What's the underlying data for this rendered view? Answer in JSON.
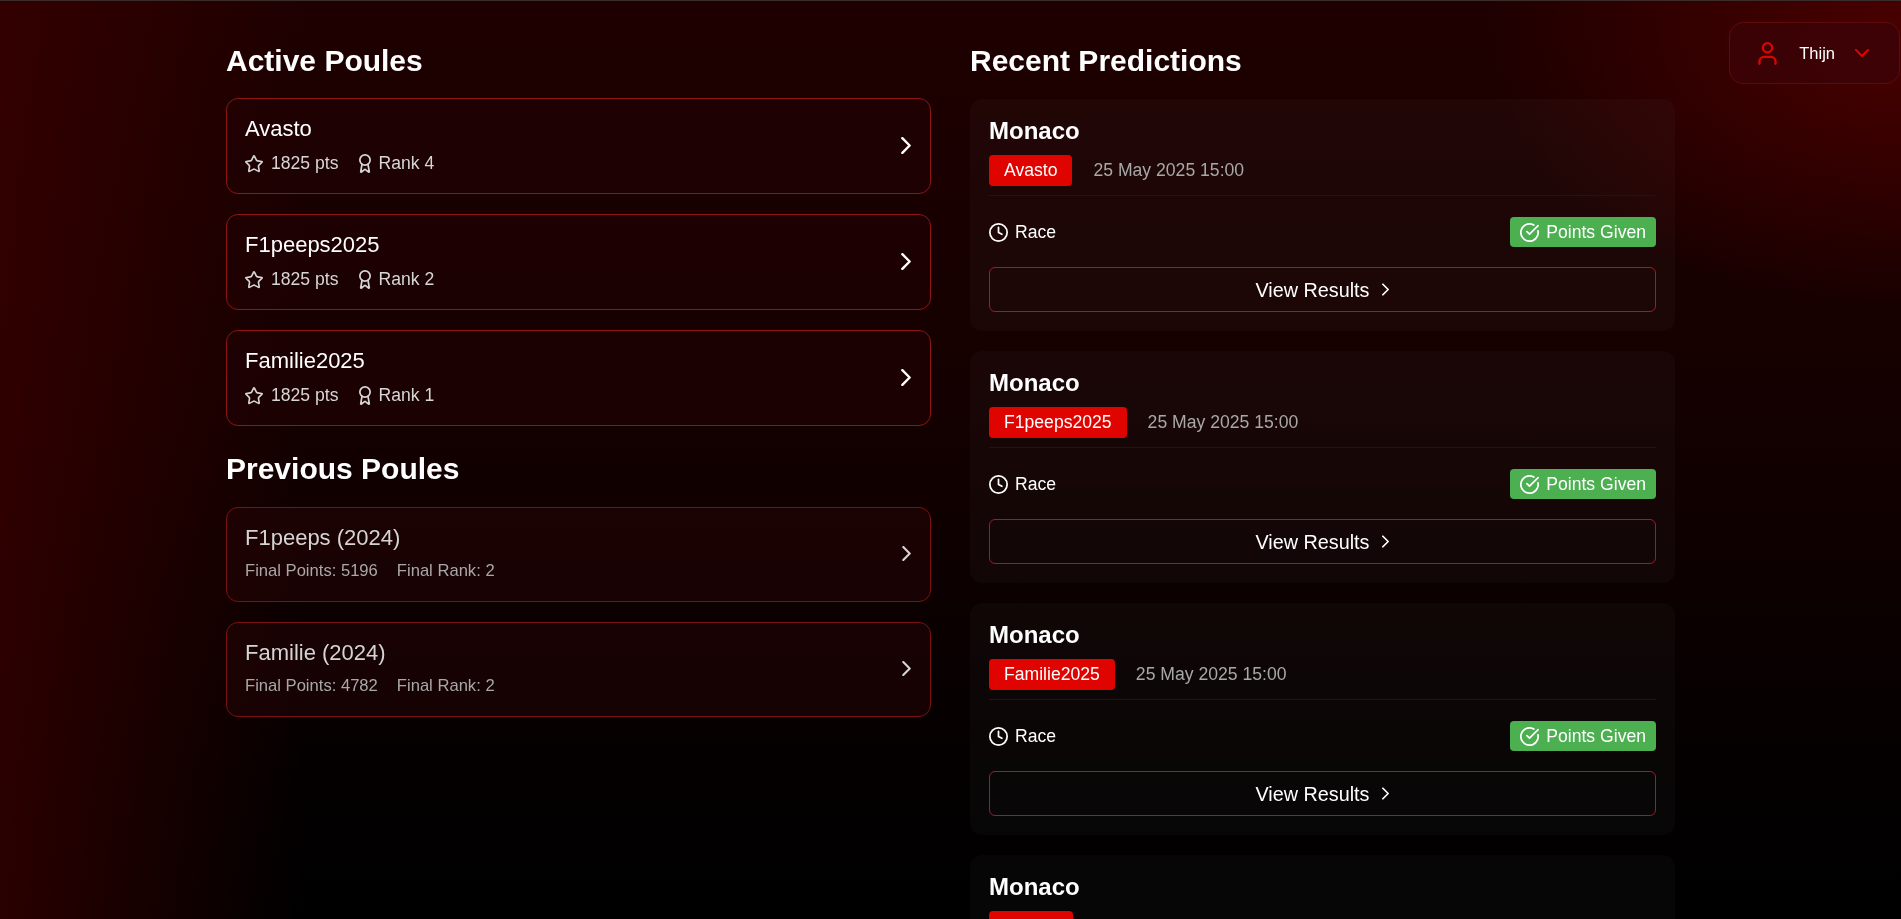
{
  "user_menu": {
    "name": "Thijn"
  },
  "active_poules": {
    "title": "Active Poules",
    "items": [
      {
        "name": "Avasto",
        "points": "1825 pts",
        "rank": "Rank 4"
      },
      {
        "name": "F1peeps2025",
        "points": "1825 pts",
        "rank": "Rank 2"
      },
      {
        "name": "Familie2025",
        "points": "1825 pts",
        "rank": "Rank 1"
      }
    ]
  },
  "previous_poules": {
    "title": "Previous Poules",
    "items": [
      {
        "name": "F1peeps (2024)",
        "final_points": "Final Points: 5196",
        "final_rank": "Final Rank: 2"
      },
      {
        "name": "Familie (2024)",
        "final_points": "Final Points: 4782",
        "final_rank": "Final Rank: 2"
      }
    ]
  },
  "recent_predictions": {
    "title": "Recent Predictions",
    "items": [
      {
        "race": "Monaco",
        "poule": "Avasto",
        "date": "25 May 2025 15:00",
        "session": "Race",
        "status": "Points Given",
        "action": "View Results",
        "cut_off": false
      },
      {
        "race": "Monaco",
        "poule": "F1peeps2025",
        "date": "25 May 2025 15:00",
        "session": "Race",
        "status": "Points Given",
        "action": "View Results",
        "cut_off": false
      },
      {
        "race": "Monaco",
        "poule": "Familie2025",
        "date": "25 May 2025 15:00",
        "session": "Race",
        "status": "Points Given",
        "action": "View Results",
        "cut_off": false
      },
      {
        "race": "Monaco",
        "cut_off": true
      }
    ]
  }
}
